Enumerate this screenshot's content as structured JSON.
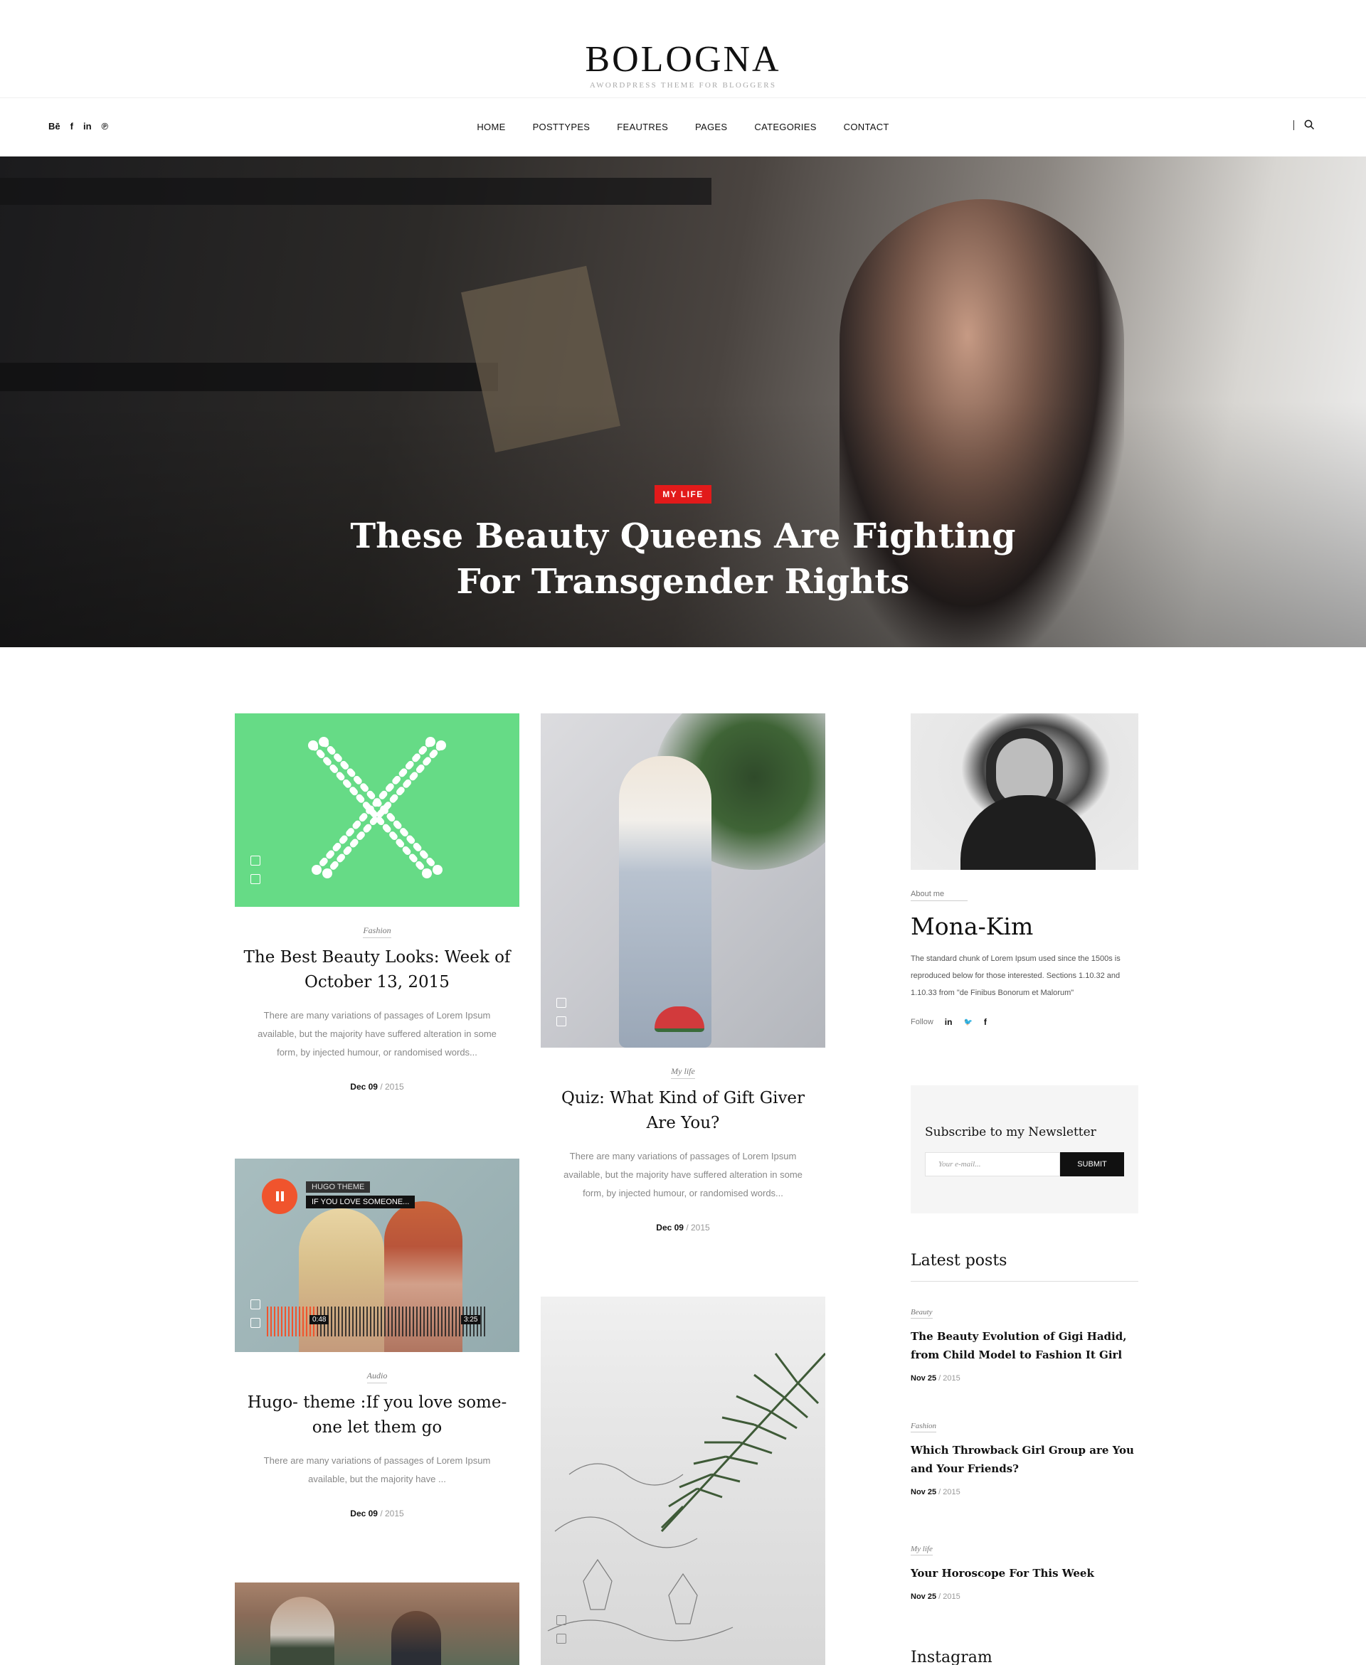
{
  "header": {
    "logo_title": "BOLOGNA",
    "logo_subtitle": "AWORDPRESS THEME FOR BLOGGERS"
  },
  "social": [
    "Bē",
    "f",
    "in",
    "℗"
  ],
  "nav": [
    "HOME",
    "POSTTYPES",
    "FEAUTRES",
    "PAGES",
    "CATEGORIES",
    "CONTACT"
  ],
  "hero": {
    "category": "MY LIFE",
    "title_line1": "These Beauty Queens Are Fighting",
    "title_line2": "For Transgender Rights"
  },
  "posts": [
    {
      "category": "Fashion",
      "title": "The Best Beauty Looks: Week of October 13, 2015",
      "excerpt": "There are many variations of passages of Lorem Ipsum available, but the majority have suffered alteration in some form, by injected humour, or randomised words...",
      "date_day": "Dec 09",
      "date_year": "/ 2015"
    },
    {
      "category": "My life",
      "title": "Quiz: What Kind of Gift Giver Are You?",
      "excerpt": "There are many variations of passages of Lorem Ipsum available, but the majority have suffered alteration in some form, by injected humour, or randomised words...",
      "date_day": "Dec 09",
      "date_year": "/ 2015"
    },
    {
      "category": "Audio",
      "title": "Hugo- theme :If you love some-one let them go",
      "excerpt": "There are many variations of passages of Lorem Ipsum available, but the majority have ...",
      "date_day": "Dec 09",
      "date_year": "/ 2015"
    }
  ],
  "audio_player": {
    "artist": "HUGO THEME",
    "track": "IF YOU LOVE SOMEONE...",
    "elapsed": "0:48",
    "duration": "3:25",
    "progress": 0.23
  },
  "about": {
    "label": "About  me",
    "name": "Mona-Kim",
    "text": "The standard chunk of Lorem Ipsum used since the 1500s is reproduced below for those interested. Sections 1.10.32 and 1.10.33 from \"de Finibus Bonorum et Malorum\"",
    "follow_label": "Follow",
    "follow_icons": [
      "in",
      "🐦",
      "f"
    ]
  },
  "newsletter": {
    "title": "Subscribe to my Newsletter",
    "placeholder": "Your e-mail...",
    "button": "SUBMIT"
  },
  "latest": {
    "title": "Latest posts",
    "items": [
      {
        "category": "Beauty",
        "title": "The Beauty Evolution of Gigi Hadid, from Child Model to Fashion It Girl",
        "date_day": "Nov 25",
        "date_year": "/ 2015"
      },
      {
        "category": "Fashion",
        "title": "Which Throwback Girl Group are You and Your Friends?",
        "date_day": "Nov 25",
        "date_year": "/ 2015"
      },
      {
        "category": "My life",
        "title": "Your Horoscope For This Week",
        "date_day": "Nov 25",
        "date_year": "/ 2015"
      }
    ]
  },
  "instagram_title": "Instagram",
  "colors": {
    "accent_red": "#e21a1a",
    "green_tile": "#66db86",
    "audio_orange": "#f0542d"
  }
}
